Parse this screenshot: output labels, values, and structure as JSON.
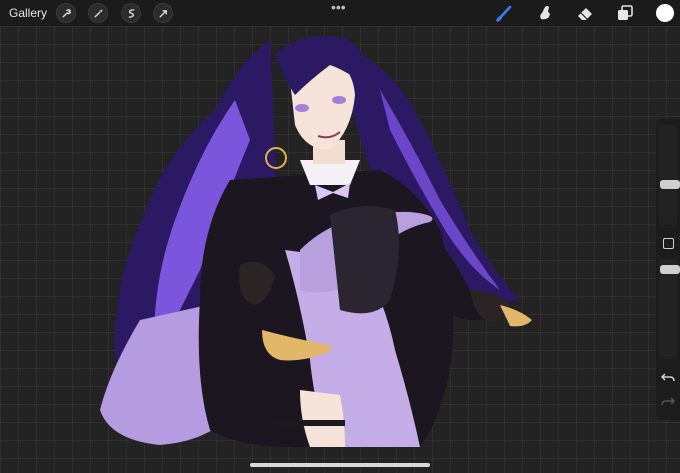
{
  "topbar": {
    "gallery_label": "Gallery",
    "left_tools": [
      "wrench-icon",
      "magic-wand-icon",
      "selection-icon",
      "transform-arrow-icon"
    ],
    "more_menu": "•••",
    "right_tools": [
      "brush-icon",
      "smudge-icon",
      "eraser-icon",
      "layers-icon"
    ],
    "active_tool": "brush-icon",
    "current_color": "#ffffff"
  },
  "colors": {
    "accent": "#3a7bfd",
    "hair": "#2a1a5c",
    "hair_highlight": "#7a52d9",
    "robe": "#1b1520",
    "dress": "#c6aee8"
  },
  "sidebar": {
    "brush_size_level": 0.55,
    "opacity_level": 0.2
  }
}
